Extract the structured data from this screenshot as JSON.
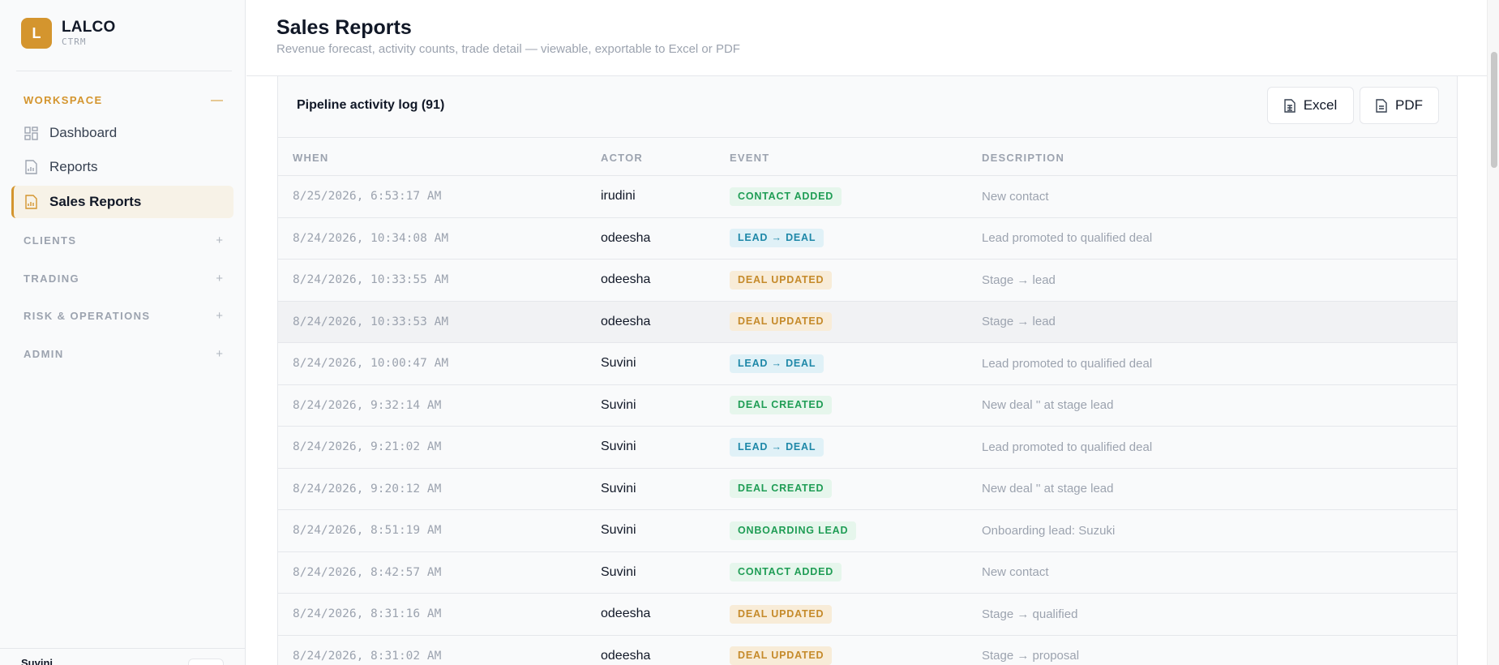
{
  "brand": {
    "initial": "L",
    "name": "LALCO",
    "sub": "CTRM"
  },
  "sidebar": {
    "workspace": {
      "label": "WORKSPACE",
      "toggle": "—"
    },
    "items": [
      {
        "label": "Dashboard",
        "icon": "dashboard-icon"
      },
      {
        "label": "Reports",
        "icon": "report-icon"
      },
      {
        "label": "Sales Reports",
        "icon": "report-icon",
        "active": true
      }
    ],
    "sections": [
      {
        "label": "CLIENTS",
        "toggle": "+"
      },
      {
        "label": "TRADING",
        "toggle": "+"
      },
      {
        "label": "RISK & OPERATIONS",
        "toggle": "+"
      },
      {
        "label": "ADMIN",
        "toggle": "+"
      }
    ],
    "footer_user": "Suvini"
  },
  "header": {
    "title": "Sales Reports",
    "subtitle": "Revenue forecast, activity counts, trade detail — viewable, exportable to Excel or PDF"
  },
  "card": {
    "title": "Pipeline activity log (91)",
    "excel_label": "Excel",
    "pdf_label": "PDF",
    "columns": [
      "WHEN",
      "ACTOR",
      "EVENT",
      "DESCRIPTION"
    ],
    "rows": [
      {
        "when": "8/25/2026, 6:53:17 AM",
        "actor": "irudini",
        "event": "CONTACT ADDED",
        "event_color": "green",
        "desc": "New contact"
      },
      {
        "when": "8/24/2026, 10:34:08 AM",
        "actor": "odeesha",
        "event": "LEAD → DEAL",
        "event_color": "blue",
        "desc": "Lead promoted to qualified deal"
      },
      {
        "when": "8/24/2026, 10:33:55 AM",
        "actor": "odeesha",
        "event": "DEAL UPDATED",
        "event_color": "amber",
        "desc": "Stage → lead"
      },
      {
        "when": "8/24/2026, 10:33:53 AM",
        "actor": "odeesha",
        "event": "DEAL UPDATED",
        "event_color": "amber",
        "desc": "Stage → lead"
      },
      {
        "when": "8/24/2026, 10:00:47 AM",
        "actor": "Suvini",
        "event": "LEAD → DEAL",
        "event_color": "blue",
        "desc": "Lead promoted to qualified deal"
      },
      {
        "when": "8/24/2026, 9:32:14 AM",
        "actor": "Suvini",
        "event": "DEAL CREATED",
        "event_color": "green",
        "desc": "New deal '' at stage lead"
      },
      {
        "when": "8/24/2026, 9:21:02 AM",
        "actor": "Suvini",
        "event": "LEAD → DEAL",
        "event_color": "blue",
        "desc": "Lead promoted to qualified deal"
      },
      {
        "when": "8/24/2026, 9:20:12 AM",
        "actor": "Suvini",
        "event": "DEAL CREATED",
        "event_color": "green",
        "desc": "New deal '' at stage lead"
      },
      {
        "when": "8/24/2026, 8:51:19 AM",
        "actor": "Suvini",
        "event": "ONBOARDING LEAD",
        "event_color": "green",
        "desc": "Onboarding lead: Suzuki"
      },
      {
        "when": "8/24/2026, 8:42:57 AM",
        "actor": "Suvini",
        "event": "CONTACT ADDED",
        "event_color": "green",
        "desc": "New contact"
      },
      {
        "when": "8/24/2026, 8:31:16 AM",
        "actor": "odeesha",
        "event": "DEAL UPDATED",
        "event_color": "amber",
        "desc": "Stage → qualified"
      },
      {
        "when": "8/24/2026, 8:31:02 AM",
        "actor": "odeesha",
        "event": "DEAL UPDATED",
        "event_color": "amber",
        "desc": "Stage → proposal"
      }
    ]
  },
  "colors": {
    "accent": "#d4952e",
    "green": "#1f9d55",
    "blue": "#1e88a8",
    "amber": "#c58a2a"
  }
}
